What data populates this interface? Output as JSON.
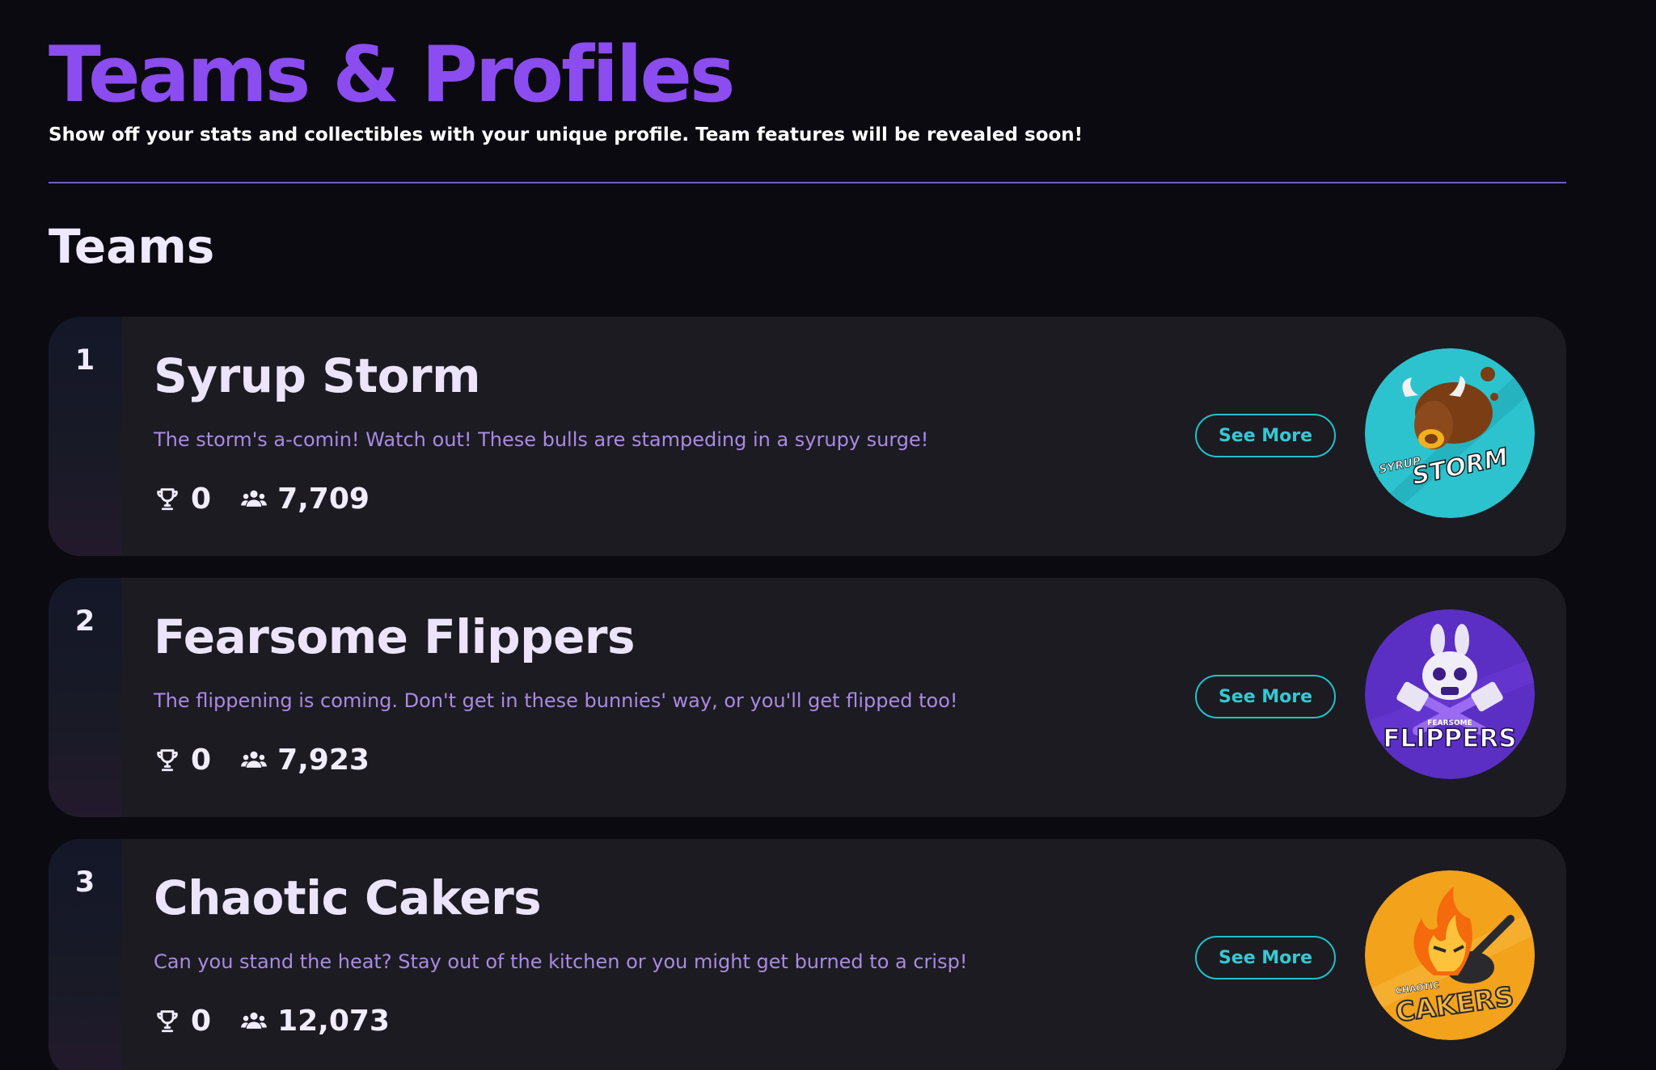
{
  "header": {
    "title": "Teams & Profiles",
    "subtitle": "Show off your stats and collectibles with your unique profile. Team features will be revealed soon!"
  },
  "section": {
    "title": "Teams"
  },
  "teams": [
    {
      "rank": "1",
      "name": "Syrup Storm",
      "description": "The storm's a-comin! Watch out! These bulls are stampeding in a syrupy surge!",
      "trophies": "0",
      "members": "7,709",
      "button_label": "See More",
      "logo_text_small": "SYRUP",
      "logo_text_big": "STORM",
      "logo_color": "#2cc3cf"
    },
    {
      "rank": "2",
      "name": "Fearsome Flippers",
      "description": "The flippening is coming. Don't get in these bunnies' way, or you'll get flipped too!",
      "trophies": "0",
      "members": "7,923",
      "button_label": "See More",
      "logo_text_small": "FEARSOME",
      "logo_text_big": "FLIPPERS",
      "logo_color": "#5b2fc4"
    },
    {
      "rank": "3",
      "name": "Chaotic Cakers",
      "description": "Can you stand the heat? Stay out of the kitchen or you might get burned to a crisp!",
      "trophies": "0",
      "members": "12,073",
      "button_label": "See More",
      "logo_text_small": "CHAOTIC",
      "logo_text_big": "CAKERS",
      "logo_color": "#f3a21c"
    }
  ],
  "icons": {
    "trophy": "trophy-icon",
    "members": "members-icon"
  },
  "colors": {
    "accent": "#8b4cf0",
    "button": "#21c1cc",
    "description": "#a98ae4"
  }
}
